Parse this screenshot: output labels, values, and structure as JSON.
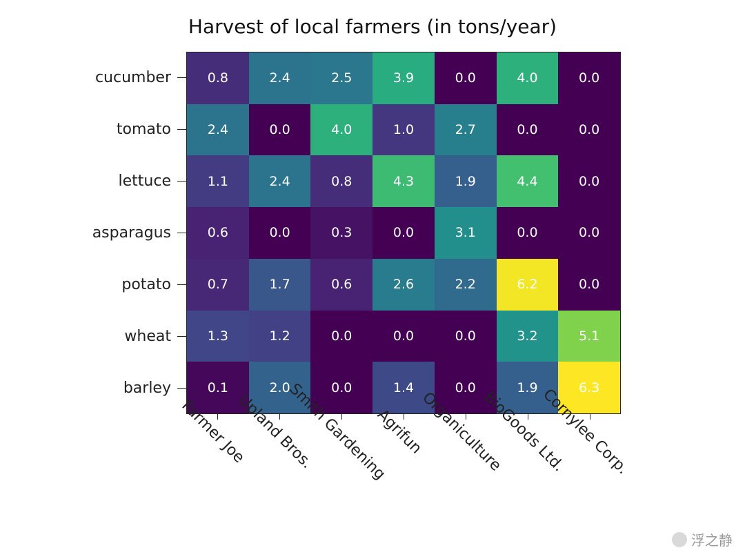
{
  "chart_data": {
    "type": "heatmap",
    "title": "Harvest of local farmers (in tons/year)",
    "xlabel": "",
    "ylabel": "",
    "x_categories": [
      "Farmer Joe",
      "Upland Bros.",
      "Smith Gardening",
      "Agrifun",
      "Organiculture",
      "BioGoods Ltd.",
      "Cornylee Corp."
    ],
    "y_categories": [
      "cucumber",
      "tomato",
      "lettuce",
      "asparagus",
      "potato",
      "wheat",
      "barley"
    ],
    "values": [
      [
        0.8,
        2.4,
        2.5,
        3.9,
        0.0,
        4.0,
        0.0
      ],
      [
        2.4,
        0.0,
        4.0,
        1.0,
        2.7,
        0.0,
        0.0
      ],
      [
        1.1,
        2.4,
        0.8,
        4.3,
        1.9,
        4.4,
        0.0
      ],
      [
        0.6,
        0.0,
        0.3,
        0.0,
        3.1,
        0.0,
        0.0
      ],
      [
        0.7,
        1.7,
        0.6,
        2.6,
        2.2,
        6.2,
        0.0
      ],
      [
        1.3,
        1.2,
        0.0,
        0.0,
        0.0,
        3.2,
        5.1
      ],
      [
        0.1,
        2.0,
        0.0,
        1.4,
        0.0,
        1.9,
        6.3
      ]
    ],
    "value_range": [
      0.0,
      6.3
    ],
    "colormap": "viridis",
    "grid": false,
    "x_tick_rotation": 45
  },
  "watermark": {
    "text": "浮之静"
  }
}
